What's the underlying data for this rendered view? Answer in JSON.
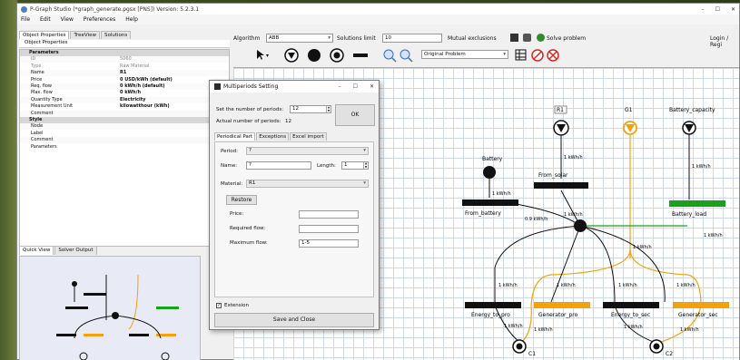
{
  "window": {
    "title": "P-Graph Studio (*graph_generate.pgsx [PNS]) Version: 5.2.3.1",
    "controls": [
      "–",
      "☐",
      "✕"
    ]
  },
  "menu": [
    "File",
    "Edit",
    "View",
    "Preferences",
    "Help"
  ],
  "left_tabs": [
    "Object Properties",
    "TreeView",
    "Solutions"
  ],
  "object_properties_title": "Object Properties",
  "properties": [
    {
      "type": "cat",
      "key": "Parameters",
      "value": ""
    },
    {
      "type": "dim",
      "key": "ID",
      "value": "5060"
    },
    {
      "type": "dim",
      "key": "Type",
      "value": "Raw Material"
    },
    {
      "type": "row",
      "key": "Name",
      "value": "R1"
    },
    {
      "type": "row",
      "key": "Price",
      "value": "0 USD/kWh (default)"
    },
    {
      "type": "row",
      "key": "Req. flow",
      "value": "0 kWh/h (default)"
    },
    {
      "type": "row",
      "key": "Max. flow",
      "value": "0 kWh/h"
    },
    {
      "type": "row",
      "key": "Quantity Type",
      "value": "Electricity"
    },
    {
      "type": "row",
      "key": "Measurement Unit",
      "value": "kilowatthour (kWh)"
    },
    {
      "type": "row",
      "key": "Comment",
      "value": ""
    },
    {
      "type": "cat",
      "key": "Style",
      "value": ""
    },
    {
      "type": "row",
      "key": "Node",
      "value": ""
    },
    {
      "type": "row",
      "key": "Label",
      "value": ""
    },
    {
      "type": "row",
      "key": "Comment",
      "value": ""
    },
    {
      "type": "row",
      "key": "Parameters",
      "value": ""
    }
  ],
  "bottom_tabs": [
    "Quick View",
    "Solver Output"
  ],
  "toolbar": {
    "algorithm_label": "Algorithm",
    "algorithm_value": "ABB",
    "solutions_limit_label": "Solutions limit",
    "solutions_limit_value": "10",
    "mutual_exclusions_label": "Mutual exclusions",
    "solve_label": "Solve problem",
    "login_label": "Login / Regi",
    "view_mode": "Original Problem"
  },
  "network": {
    "labels": {
      "r1": "R1",
      "g1": "G1",
      "battery_capacity": "Battery_capacity",
      "battery": "Battery",
      "from_solar": "From_solar",
      "from_battery": "From_battery",
      "battery_load": "Battery_load",
      "energy_to_pro": "Energy_to_pro",
      "generator_pro": "Generator_pro",
      "energy_to_sec": "Energy_to_sec",
      "generator_sec": "Generator_sec",
      "c1": "C1",
      "c2": "C2"
    },
    "flow_labels": [
      "1 kWh/h",
      "1 kWh/h",
      "1 kWh/h",
      "0.9 kWh/h",
      "1 kWh/h",
      "1 kWh/h",
      "1 kWh/h",
      "1 kWh/h",
      "1 kWh/h",
      "1 kWh/h",
      "1 kWh/h",
      "1 kWh/h",
      "1 kWh/h",
      "1 kWh/h",
      "1 kWh/h"
    ]
  },
  "dialog": {
    "title": "Multiperiods Setting",
    "controls": [
      "–",
      "☐",
      "✕"
    ],
    "set_periods_label": "Set the number of periods:",
    "set_periods_value": "12",
    "actual_periods_label": "Actual number of periods:",
    "actual_periods_value": "12",
    "ok_label": "OK",
    "tabs": [
      "Periodical Part",
      "Exceptions",
      "Excel import"
    ],
    "period_label": "Period:",
    "period_value": "?",
    "name_label": "Name:",
    "name_value": "?",
    "length_label": "Length:",
    "length_value": "1",
    "material_label": "Material:",
    "material_value": "R1",
    "restore_label": "Restore",
    "price_label": "Price:",
    "price_value": "",
    "required_flow_label": "Required flow:",
    "required_flow_value": "",
    "maximum_flow_label": "Maximum flow:",
    "maximum_flow_value": "1-5",
    "extension_label": "Extension",
    "extension_checked": "✓",
    "save_close_label": "Save and Close"
  },
  "colors": {
    "orange": "#f5a20a",
    "green": "#16a31a",
    "black": "#111111",
    "red": "#d9261c"
  }
}
